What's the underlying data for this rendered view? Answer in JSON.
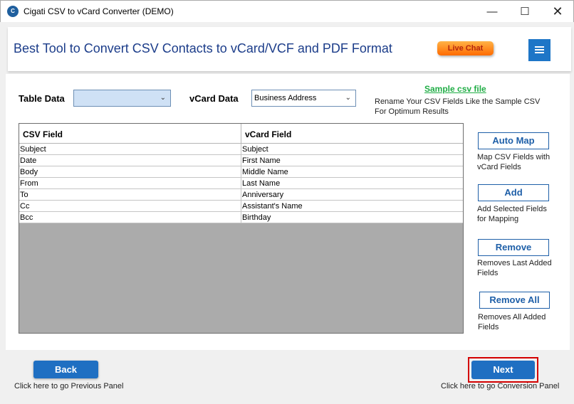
{
  "window": {
    "title": "Cigati CSV to vCard Converter (DEMO)",
    "icon_text": "C",
    "minimize_glyph": "—",
    "maximize_glyph": "☐",
    "close_glyph": "✕"
  },
  "header": {
    "title": "Best Tool to Convert CSV Contacts to vCard/VCF and PDF Format",
    "live_chat": "Live Chat",
    "menu_icon": "hamburger-icon"
  },
  "mapping": {
    "table_data_label": "Table Data",
    "table_data_value": "",
    "vcard_data_label": "vCard Data",
    "vcard_data_value": "Business Address",
    "sample_link": "Sample csv file",
    "sample_hint": "Rename Your CSV Fields Like the Sample CSV For Optimum Results"
  },
  "grid": {
    "columns": [
      "CSV Field",
      "vCard Field"
    ],
    "rows": [
      [
        "Subject",
        "Subject"
      ],
      [
        "Date",
        "First Name"
      ],
      [
        "Body",
        "Middle Name"
      ],
      [
        "From",
        "Last Name"
      ],
      [
        "To",
        "Anniversary"
      ],
      [
        "Cc",
        "Assistant's Name"
      ],
      [
        "Bcc",
        "Birthday"
      ]
    ]
  },
  "actions": {
    "auto_map": "Auto Map",
    "auto_map_desc": "Map CSV Fields with vCard Fields",
    "add": "Add",
    "add_desc": "Add Selected Fields for Mapping",
    "remove": "Remove",
    "remove_desc": "Removes Last Added Fields",
    "remove_all": "Remove All",
    "remove_all_desc": "Removes All Added Fields"
  },
  "footer": {
    "back": "Back",
    "back_desc": "Click here to go Previous Panel",
    "next": "Next",
    "next_desc": "Click here to go Conversion Panel"
  },
  "colors": {
    "accent": "#1f6fc2",
    "title_blue": "#1c3d8a",
    "link_green": "#1fad45",
    "highlight_red": "#d40000"
  }
}
